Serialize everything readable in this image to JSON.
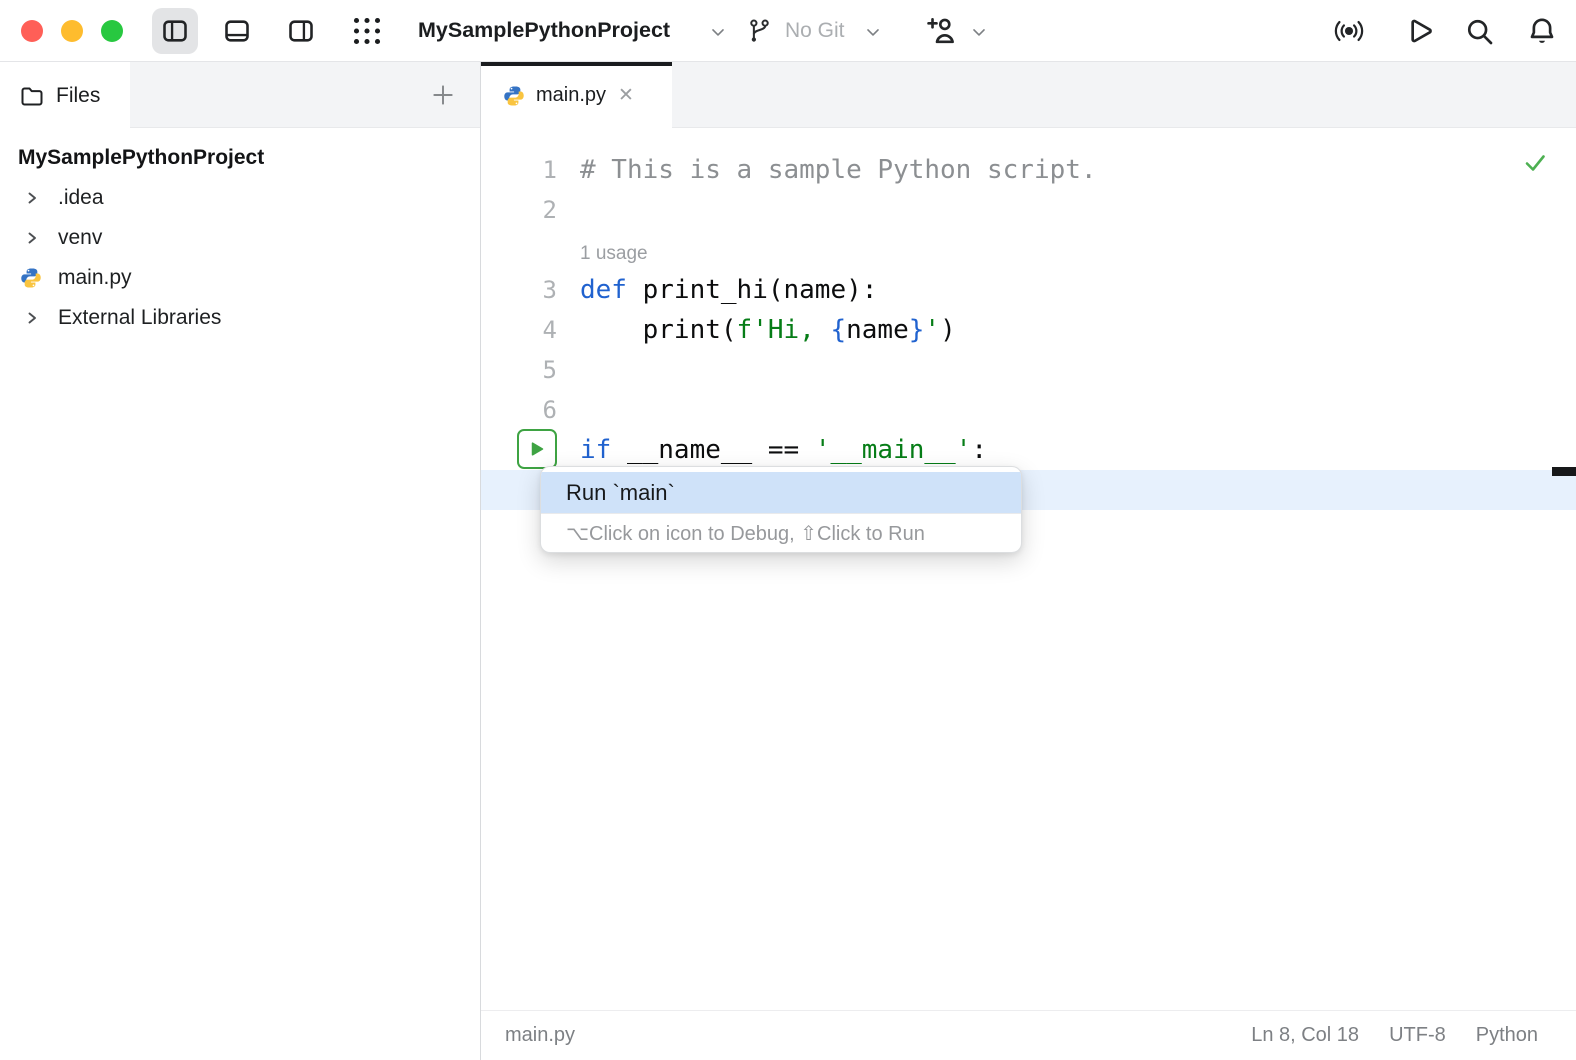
{
  "toolbar": {
    "project_name": "MySamplePythonProject",
    "vcs_label": "No Git"
  },
  "sidebar": {
    "tab_label": "Files",
    "tree": {
      "root": "MySamplePythonProject",
      "items": [
        {
          "label": ".idea",
          "type": "folder-collapsed"
        },
        {
          "label": "venv",
          "type": "folder-collapsed"
        },
        {
          "label": "main.py",
          "type": "python-file"
        },
        {
          "label": "External Libraries",
          "type": "folder-collapsed"
        }
      ]
    }
  },
  "editor": {
    "tab_label": "main.py",
    "rows": [
      {
        "num": "1",
        "tokens": [
          {
            "c": "comment",
            "t": "# This is a sample Python script."
          }
        ]
      },
      {
        "num": "2",
        "tokens": []
      },
      {
        "inlay": "1 usage"
      },
      {
        "num": "3",
        "tokens": [
          {
            "c": "kw",
            "t": "def"
          },
          {
            "c": "plain",
            "t": " print_hi(name):"
          }
        ]
      },
      {
        "num": "4",
        "tokens": [
          {
            "c": "plain",
            "t": "    print("
          },
          {
            "c": "str",
            "t": "f'Hi, "
          },
          {
            "c": "brace",
            "t": "{"
          },
          {
            "c": "plain",
            "t": "name"
          },
          {
            "c": "brace",
            "t": "}"
          },
          {
            "c": "str",
            "t": "'"
          },
          {
            "c": "plain",
            "t": ")"
          }
        ]
      },
      {
        "num": "5",
        "tokens": []
      },
      {
        "num": "6",
        "tokens": []
      },
      {
        "num": "",
        "run": true,
        "tokens": [
          {
            "c": "kw",
            "t": "if"
          },
          {
            "c": "plain",
            "t": " __name__ == "
          },
          {
            "c": "str",
            "t": "'__main__'"
          },
          {
            "c": "plain",
            "t": ":"
          }
        ]
      }
    ],
    "popup": {
      "primary": "Run `main`",
      "hint": "⌥Click on icon to Debug, ⇧Click to Run"
    }
  },
  "status_bar": {
    "file": "main.py",
    "position": "Ln 8, Col 18",
    "encoding": "UTF-8",
    "language": "Python"
  },
  "icons": {
    "close_glyph": "✕"
  },
  "colors": {
    "traffic_red": "#ff5f57",
    "traffic_yellow": "#febc2e",
    "traffic_green": "#28c840",
    "kw": "#2062cf",
    "str": "#067d17",
    "comment": "#8c8f92",
    "brace": "#2062cf",
    "plain": "#0c0d0e",
    "run_green": "#3ea343",
    "check_green": "#4db052",
    "band": "#e7f1fd",
    "sel": "#cfe2f9"
  }
}
